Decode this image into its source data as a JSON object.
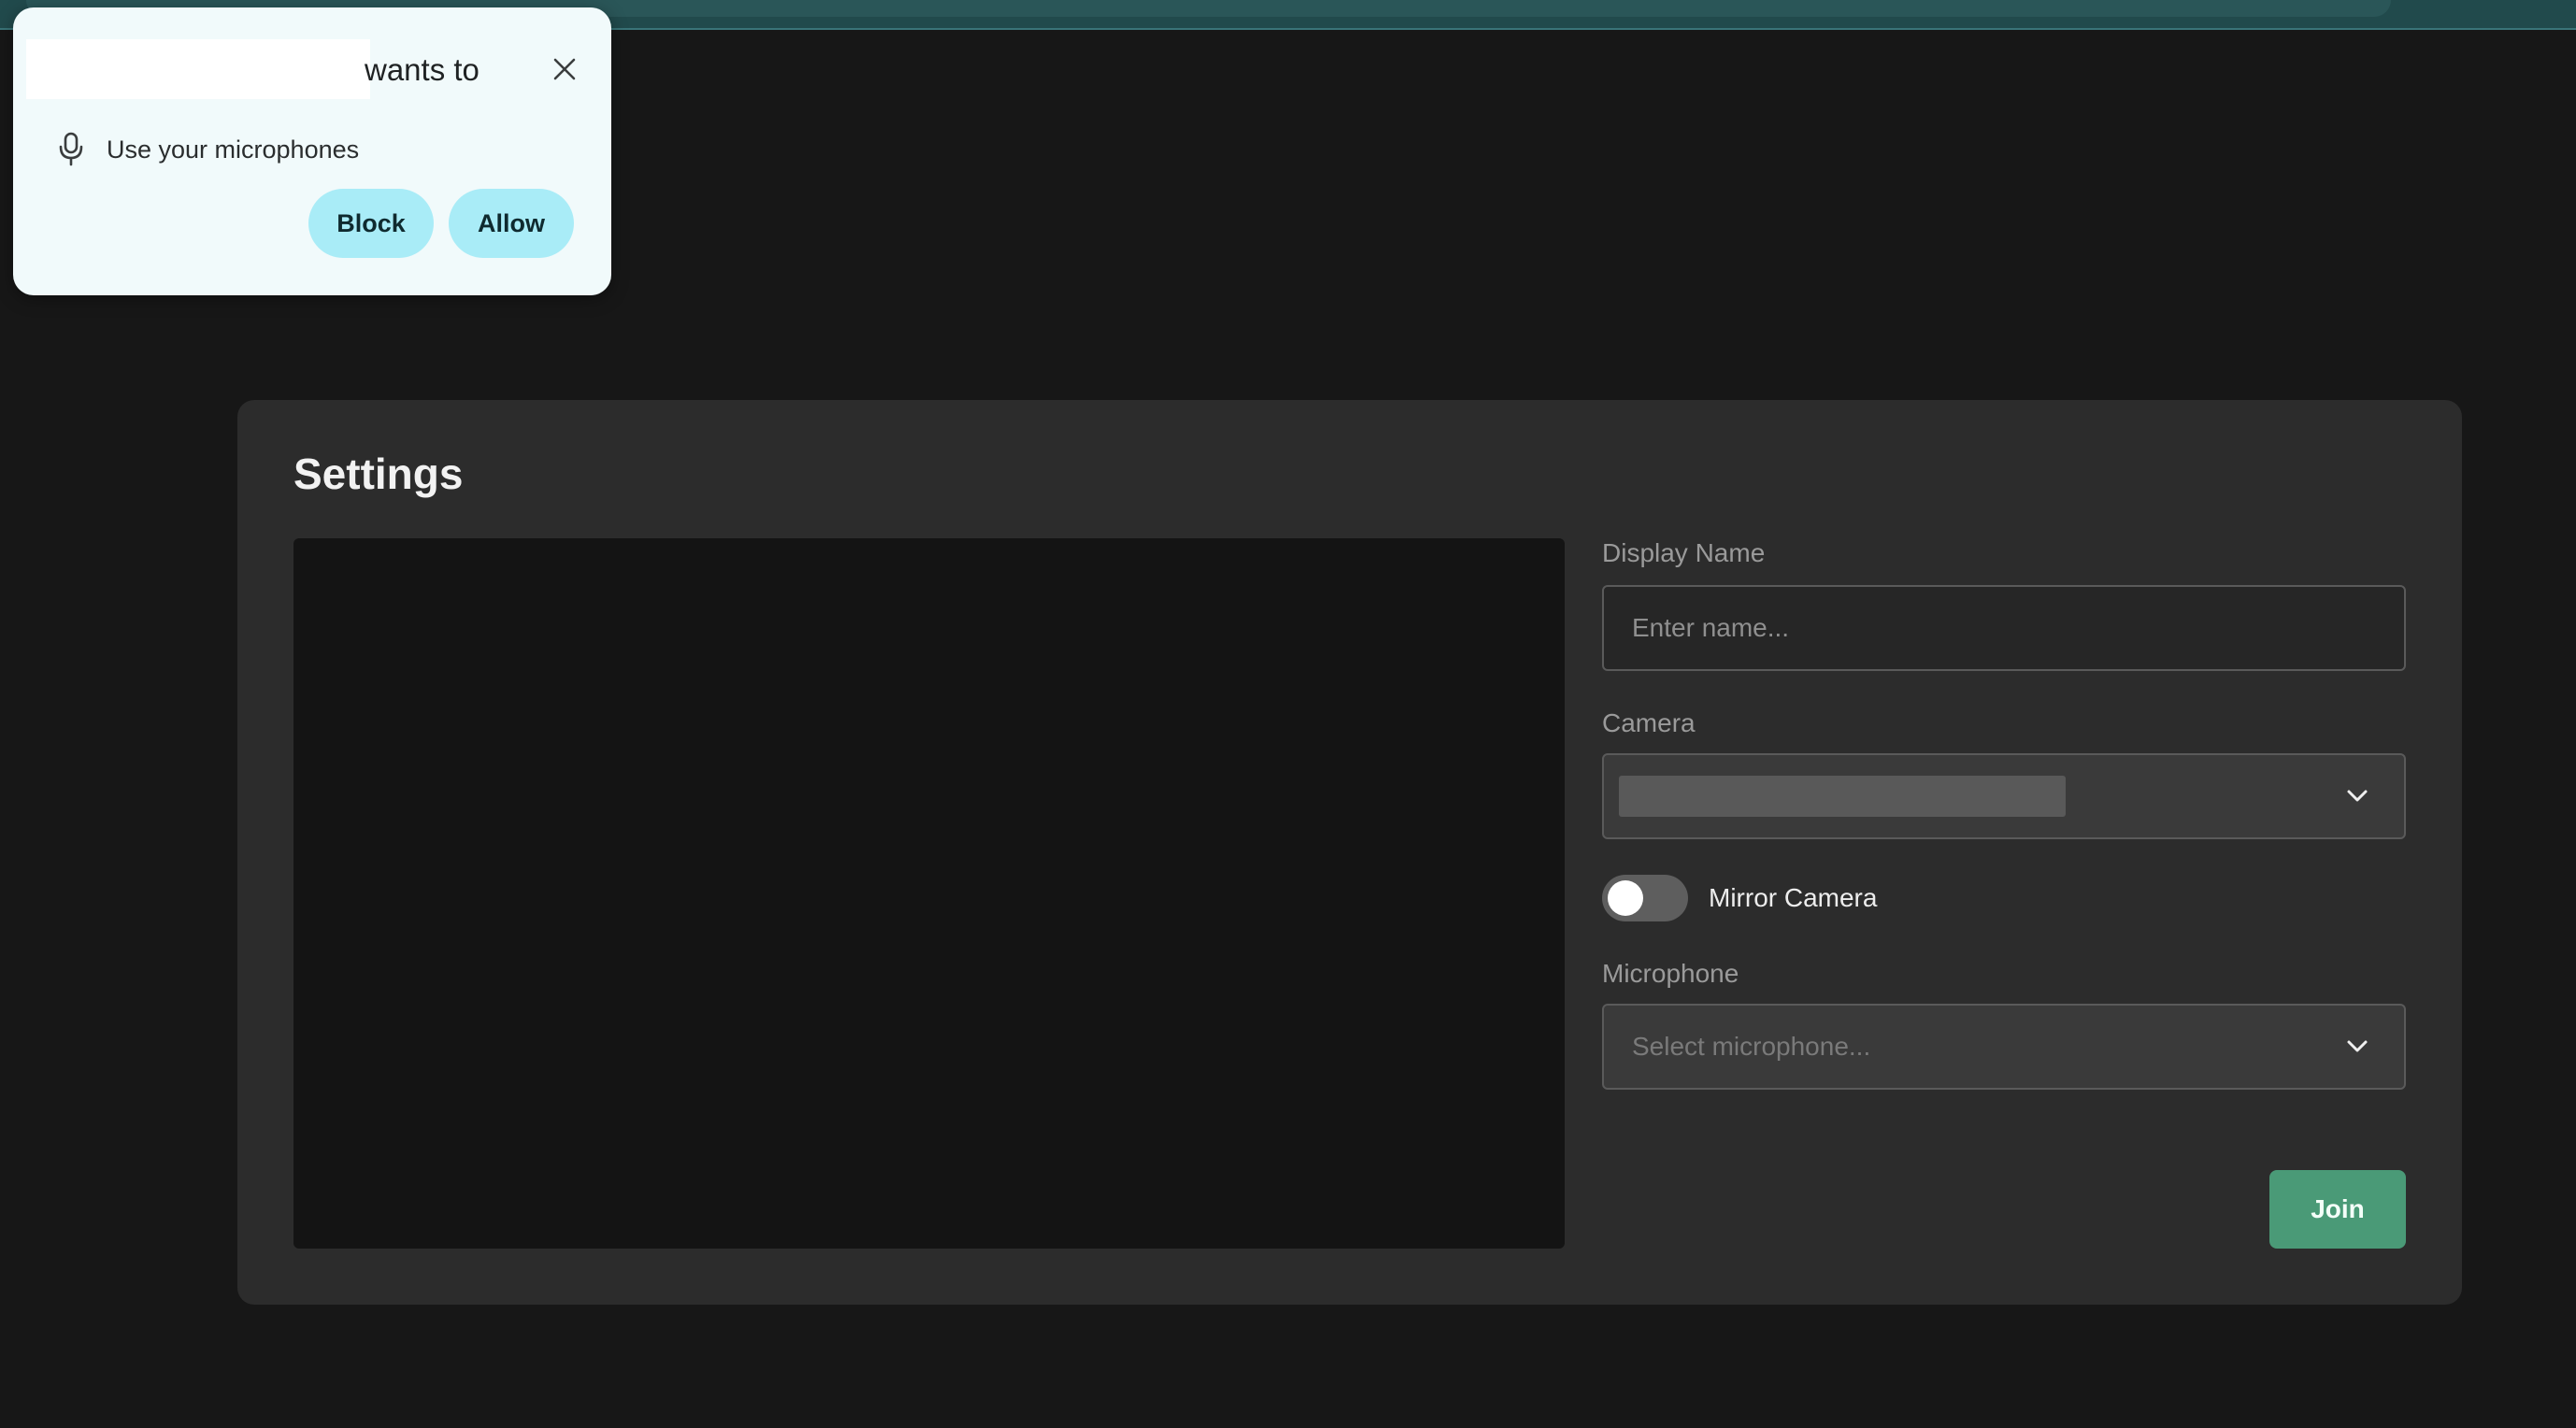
{
  "popup": {
    "title_suffix": "wants to",
    "permission_text": "Use your microphones",
    "block_label": "Block",
    "allow_label": "Allow"
  },
  "settings": {
    "heading": "Settings",
    "display_name": {
      "label": "Display Name",
      "value": "",
      "placeholder": "Enter name..."
    },
    "camera": {
      "label": "Camera",
      "selected": ""
    },
    "mirror_camera": {
      "label": "Mirror Camera",
      "enabled": false
    },
    "microphone": {
      "label": "Microphone",
      "placeholder": "Select microphone..."
    },
    "join_label": "Join"
  },
  "icons": {
    "permission": "microphone-icon",
    "close": "close-icon",
    "dropdown": "chevron-down-icon"
  },
  "colors": {
    "join_button": "#4a9a77",
    "popup_button": "#a9ecf7",
    "card_background": "#2c2c2c",
    "page_background": "#171717"
  }
}
